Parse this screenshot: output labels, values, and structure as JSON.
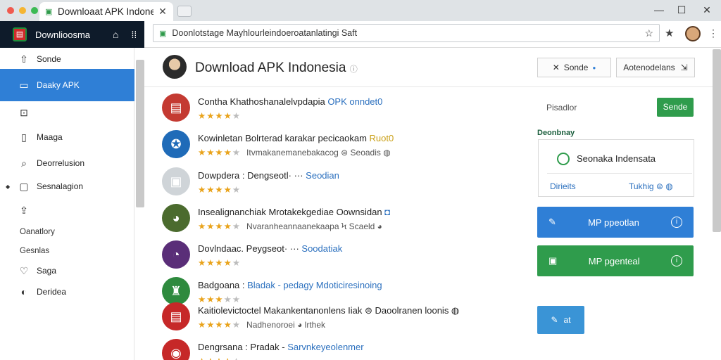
{
  "window": {
    "tab_title": "Downloaat APK Indoneso",
    "tab_close": "✕",
    "min_glyph": "—",
    "max_glyph": "☐",
    "close_glyph": "✕"
  },
  "address_bar": {
    "url": "Doonlotstage Mayhlourleindoeroatanlatingi Saft",
    "lock_icon": "lock-icon"
  },
  "sidebar": {
    "title": "Downlioosma",
    "items": [
      {
        "label": "Sonde",
        "icon": "⇧"
      },
      {
        "label": "Daaky APK",
        "icon": "▭"
      },
      {
        "label": "",
        "icon": "⊡"
      },
      {
        "label": "Maaga",
        "icon": "▯"
      },
      {
        "label": "Deorrelusion",
        "icon": "⌕"
      },
      {
        "label": "Sesnalagion",
        "icon": "▢"
      },
      {
        "label": "",
        "icon": "⇪"
      }
    ],
    "text_items": [
      "Oanatlory",
      "Gesnlas"
    ],
    "bottom_items": [
      {
        "label": "Saga",
        "icon": "♡"
      },
      {
        "label": "Deridea",
        "icon": "◐"
      }
    ]
  },
  "header": {
    "title": "Download APK Indonesia",
    "title_suffix": "ⓘ",
    "button1_icon": "✕",
    "button1_label": "Sonde",
    "button1_dot": "●",
    "button2_label": "Aotenodelans",
    "button2_arrow": "⇲"
  },
  "apps": [
    {
      "name": "Contha Khathoshanalelvpdapia ",
      "name_hl": "OPK onndet0",
      "sub": "",
      "rating": 3.5,
      "icon_color": "#c43a32",
      "icon_glyph": "▤"
    },
    {
      "name": "Kowinletan Bolrterad karakar pecicaokam ",
      "name_hl": "Ruot0",
      "sub": "Itvmakanemanebakacog ⊜ Seoadis ◍",
      "rating": 3.5,
      "icon_color": "#1f6bb8",
      "icon_glyph": "✪"
    },
    {
      "name": "Dowpdera  : Dengseotl· ··· ",
      "name_hl": "Seodian",
      "sub": "",
      "rating": 4,
      "icon_color": "#cfd4d8",
      "icon_glyph": "▣"
    },
    {
      "name": "Insealignanchiak Mrotakekgediae Oownsidan ",
      "name_hl": "◘",
      "sub": "Nvaranheannaanekaapa Ϟ Scaeld ◕",
      "rating": 3.5,
      "icon_color": "#4b6b2e",
      "icon_glyph": "◕"
    },
    {
      "name": "Dovlndaac. Peygseot· ··· ",
      "name_hl": "Soodatiak",
      "sub": "",
      "rating": 4,
      "icon_color": "#5a2e78",
      "icon_glyph": "◔"
    },
    {
      "name": "Badgoana  : ",
      "name_hl": "Bladak - pedagy Mdoticiresinoing",
      "sub": "",
      "rating": 3,
      "icon_color": "#2e8a3e",
      "icon_glyph": "♜"
    },
    {
      "name": "Kaitiolevictoctel Makankentanonlens Iiak ⊜ Daoolranen loonis ◍",
      "name_hl": "",
      "sub": "Nadhenoroei ◕ lrthek",
      "rating": 3.5,
      "icon_color": "#c62828",
      "icon_glyph": "▤"
    },
    {
      "name": "Dengrsana  : Pradak - ",
      "name_hl": "Sarvnkeyeolenmer",
      "sub": "",
      "rating": 4,
      "icon_color": "#c62828",
      "icon_glyph": "◉"
    }
  ],
  "right_panel": {
    "search_label": "Pisadlor",
    "search_button": "Sende",
    "category_label": "Deonbnay",
    "card_title": "Seonaka Indensata",
    "card_left": "Dirieits",
    "card_right": "Tukhig ⊜ ◍",
    "button_blue": "MP ppeotlan",
    "button_green": "MP pgenteal",
    "button_blue_icon": "✎",
    "button_green_icon": "▣",
    "button_small": "at",
    "button_small_icon": "✎"
  },
  "colors": {
    "accent_blue": "#2f7fd6",
    "accent_green": "#2f9c4c",
    "sidebar_head": "#0e1b2a",
    "star_on": "#e9a31b",
    "star_off": "#bcbcbc"
  }
}
